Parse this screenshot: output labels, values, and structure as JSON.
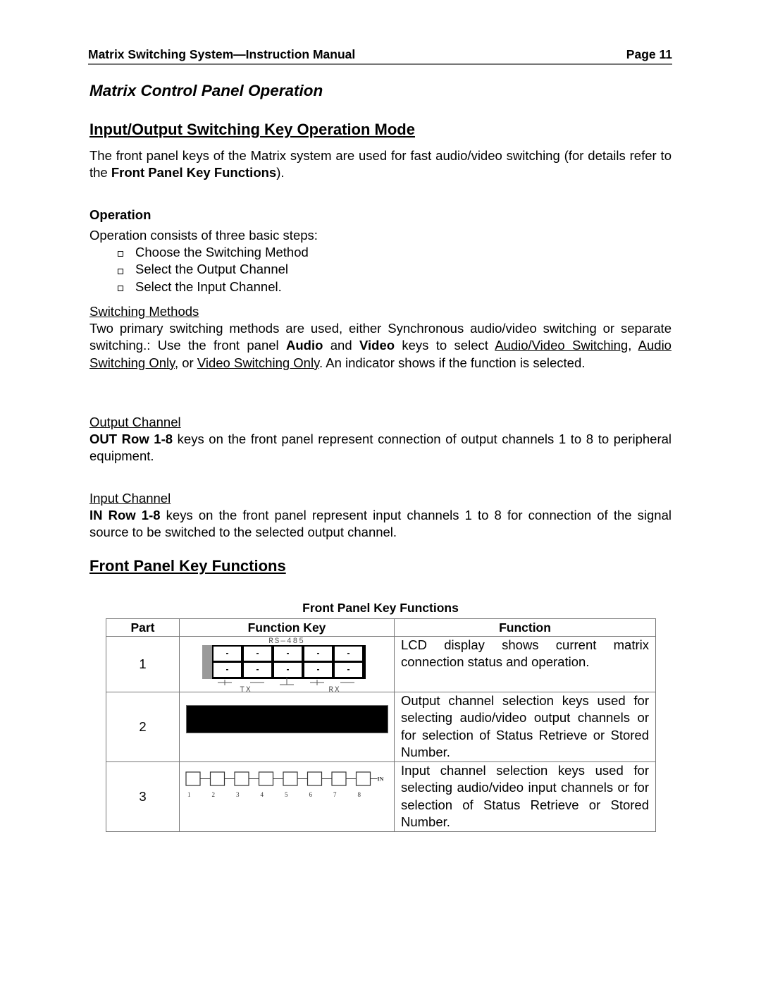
{
  "header": {
    "manual_title": "Matrix Switching System—Instruction Manual",
    "page_label": "Page 11"
  },
  "section_title": "Matrix Control Panel Operation",
  "io_mode": {
    "heading": "Input/Output Switching Key Operation Mode",
    "intro_pre": "The front panel keys of the Matrix system are used for fast audio/video switching (for details refer to the ",
    "intro_bold": "Front Panel Key Functions",
    "intro_post": ")."
  },
  "operation": {
    "heading": "Operation",
    "lead": "Operation consists of three basic steps:",
    "steps": [
      "Choose the Switching Method",
      "Select the Output Channel",
      "Select the Input Channel."
    ]
  },
  "switching_methods": {
    "heading": "Switching Methods",
    "t1": "Two primary switching methods are used, either Synchronous audio/video switching or separate switching.: Use the front panel ",
    "b1": "Audio",
    "t2": " and ",
    "b2": "Video",
    "t3": " keys to select ",
    "u1": "Audio/Video Switching",
    "t4": ", ",
    "u2": "Audio Switching Only",
    "t5": ", or ",
    "u3": "Video Switching Only",
    "t6": ".  An indicator shows if the function is selected."
  },
  "output_channel": {
    "heading": "Output Channel",
    "bold": "OUT Row 1-8",
    "text": " keys on the front panel represent connection of output channels 1 to 8 to peripheral equipment."
  },
  "input_channel": {
    "heading": "Input Channel",
    "bold": "IN Row 1-8",
    "text": " keys on the front panel represent input channels 1 to 8 for connection of the signal source to be switched to the selected output channel."
  },
  "key_functions": {
    "heading": "Front Panel Key Functions",
    "table_caption": "Front Panel Key Functions",
    "columns": [
      "Part",
      "Function Key",
      "Function"
    ],
    "rows": [
      {
        "part": "1",
        "key_image": "lcd-display-diagram",
        "lcd_labels": {
          "top": "RS—485",
          "tx": "TX",
          "rx": "RX"
        },
        "function": "LCD display shows current matrix connection status and operation."
      },
      {
        "part": "2",
        "key_image": "output-keys-bar",
        "function": "Output channel selection keys used for selecting audio/video output channels or for selection of Status Retrieve or Stored Number."
      },
      {
        "part": "3",
        "key_image": "input-keys-diagram",
        "input_key_numbers": [
          "1",
          "2",
          "3",
          "4",
          "5",
          "6",
          "7",
          "8"
        ],
        "input_key_tag": "IN",
        "function": "Input channel selection keys used for selecting audio/video input channels or for selection of Status Retrieve or Stored Number."
      }
    ]
  }
}
